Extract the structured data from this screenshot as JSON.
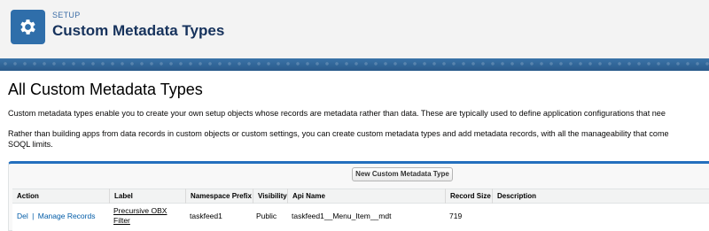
{
  "header": {
    "kicker": "SETUP",
    "title": "Custom Metadata Types",
    "icon": "gear-icon",
    "icon_bg": "#2f6eaa"
  },
  "main": {
    "page_title": "All Custom Metadata Types",
    "description_1": "Custom metadata types enable you to create your own setup objects whose records are metadata rather than data. These are typically used to define application configurations that nee",
    "description_2_line1": "Rather than building apps from data records in custom objects or custom settings, you can create custom metadata types and add metadata records, with all the manageability that come",
    "description_2_line2": "SOQL limits.",
    "new_button_label": "New Custom Metadata Type"
  },
  "table": {
    "columns": [
      "Action",
      "Label",
      "Namespace Prefix",
      "Visibility",
      "Api Name",
      "Record Size",
      "Description"
    ],
    "rows": [
      {
        "action_del": "Del",
        "action_separator": "|",
        "action_manage": "Manage Records",
        "label_line1": "Precursive OBX",
        "label_line2": "Filter",
        "namespace_prefix": "taskfeed1",
        "visibility": "Public",
        "api_name": "taskfeed1__Menu_Item__mdt",
        "record_size": "719",
        "description": ""
      }
    ]
  },
  "colors": {
    "accent": "#236fbd",
    "link": "#015ba7",
    "title": "#16325c"
  }
}
